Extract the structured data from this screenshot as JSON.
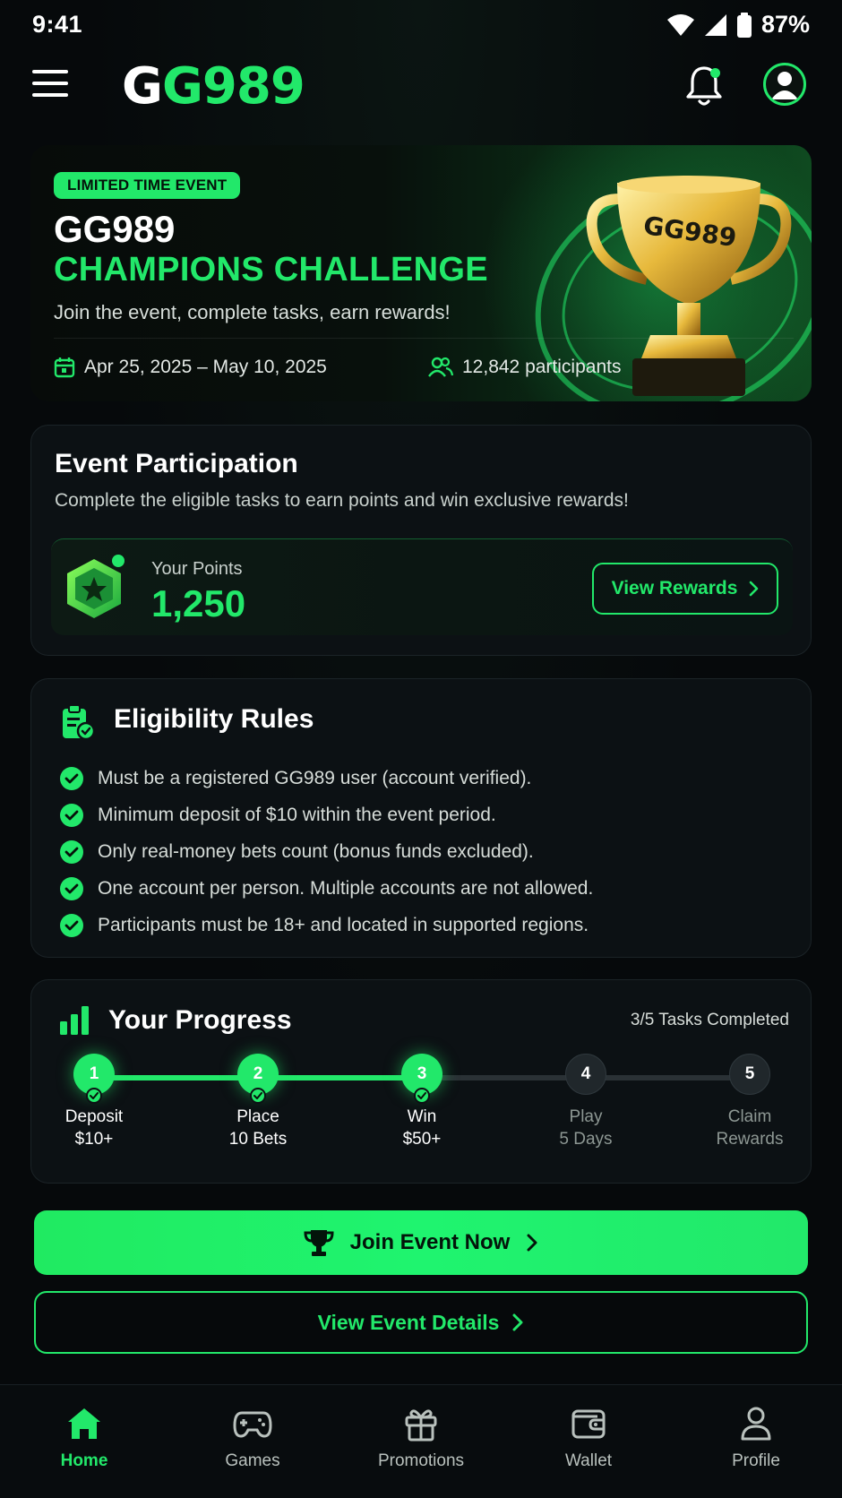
{
  "status_bar": {
    "time": "9:41",
    "battery": "87%"
  },
  "header": {
    "logo_first": "G",
    "logo_rest": "G989"
  },
  "hero": {
    "badge": "LIMITED TIME EVENT",
    "title_line1": "GG989",
    "title_line2": "CHAMPIONS CHALLENGE",
    "subtitle": "Join the event, complete tasks, earn rewards!",
    "dates": "Apr 25, 2025 – May 10, 2025",
    "participants": "12,842 participants",
    "trophy_text": "GG989"
  },
  "participation": {
    "title": "Event Participation",
    "subtitle": "Complete the eligible tasks to earn points and win exclusive rewards!",
    "points_label": "Your Points",
    "points_value": "1,250",
    "view_rewards": "View Rewards"
  },
  "rules": {
    "title": "Eligibility Rules",
    "items": [
      "Must be a registered GG989 user (account verified).",
      "Minimum deposit of $10 within the event period.",
      "Only real-money bets count (bonus funds excluded).",
      "One account per person. Multiple accounts are not allowed.",
      "Participants must be 18+ and located in supported regions."
    ]
  },
  "progress": {
    "title": "Your Progress",
    "count": "3/5 Tasks Completed",
    "completed_fraction": 0.5,
    "steps": [
      {
        "num": "1",
        "line1": "Deposit",
        "line2": "$10+",
        "done": true
      },
      {
        "num": "2",
        "line1": "Place",
        "line2": "10 Bets",
        "done": true
      },
      {
        "num": "3",
        "line1": "Win",
        "line2": "$50+",
        "done": true
      },
      {
        "num": "4",
        "line1": "Play",
        "line2": "5 Days",
        "done": false
      },
      {
        "num": "5",
        "line1": "Claim",
        "line2": "Rewards",
        "done": false
      }
    ]
  },
  "actions": {
    "join": "Join Event Now",
    "details": "View Event Details"
  },
  "nav": {
    "items": [
      {
        "label": "Home",
        "icon": "home-icon",
        "active": true
      },
      {
        "label": "Games",
        "icon": "gamepad-icon",
        "active": false
      },
      {
        "label": "Promotions",
        "icon": "gift-icon",
        "active": false
      },
      {
        "label": "Wallet",
        "icon": "wallet-icon",
        "active": false
      },
      {
        "label": "Profile",
        "icon": "user-icon",
        "active": false
      }
    ]
  },
  "colors": {
    "accent": "#22e86a",
    "background": "#06090b",
    "card": "#0c1114"
  }
}
